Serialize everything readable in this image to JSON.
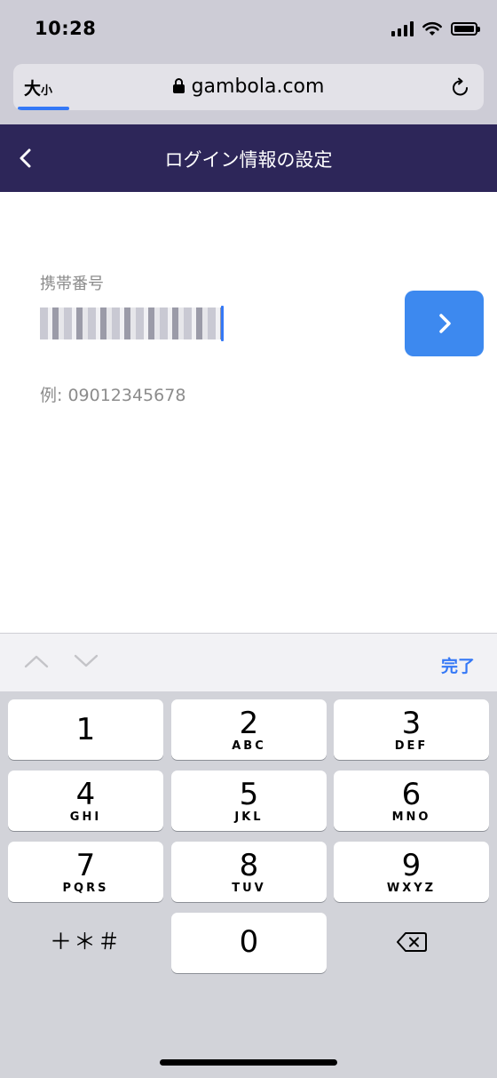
{
  "status_bar": {
    "time": "10:28"
  },
  "browser": {
    "text_size_big": "大",
    "text_size_small": "小",
    "url": "gambola.com"
  },
  "header": {
    "title": "ログイン情報の設定"
  },
  "form": {
    "label": "携帯番号",
    "value": "09012345678",
    "hint": "例: 09012345678"
  },
  "keyboard": {
    "done_label": "完了",
    "symbols_label": "＋＊＃",
    "keys": [
      {
        "digit": "1",
        "letters": ""
      },
      {
        "digit": "2",
        "letters": "ABC"
      },
      {
        "digit": "3",
        "letters": "DEF"
      },
      {
        "digit": "4",
        "letters": "GHI"
      },
      {
        "digit": "5",
        "letters": "JKL"
      },
      {
        "digit": "6",
        "letters": "MNO"
      },
      {
        "digit": "7",
        "letters": "PQRS"
      },
      {
        "digit": "8",
        "letters": "TUV"
      },
      {
        "digit": "9",
        "letters": "WXYZ"
      },
      {
        "digit": "0",
        "letters": ""
      }
    ]
  },
  "colors": {
    "header_bg": "#2d2659",
    "accent": "#3d89ef",
    "link": "#3478f6"
  }
}
